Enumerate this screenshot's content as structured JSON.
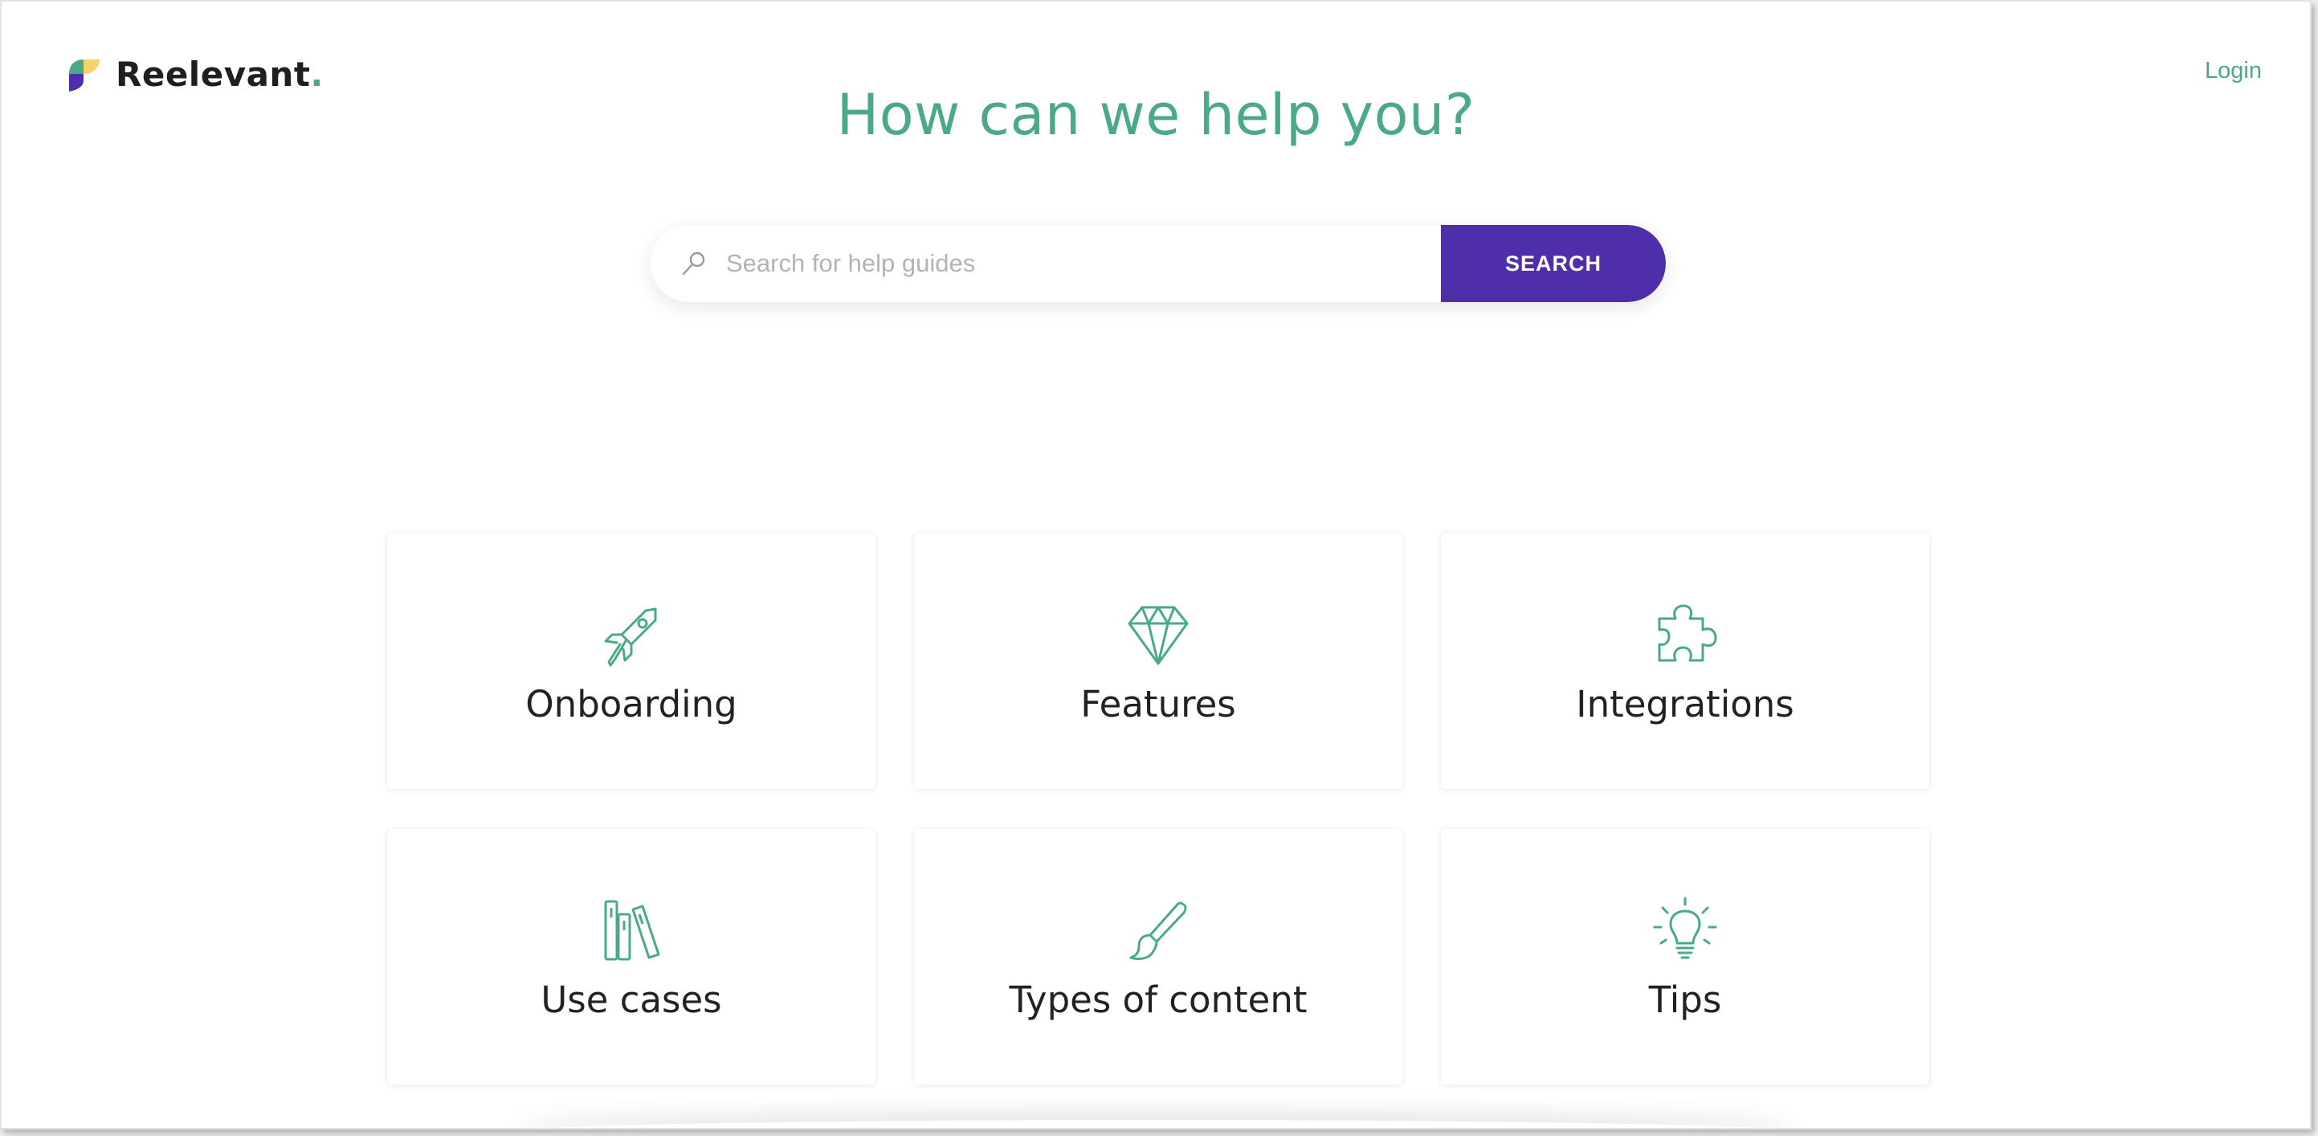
{
  "brand": {
    "name": "Reelevant",
    "dot": ".",
    "colors": {
      "green": "#4aa989",
      "purple": "#4f2fa9",
      "yellow": "#f7d36b"
    }
  },
  "header": {
    "login_label": "Login"
  },
  "hero": {
    "title": "How can we help you?"
  },
  "search": {
    "placeholder": "Search for help guides",
    "button_label": "SEARCH"
  },
  "categories": [
    {
      "label": "Onboarding",
      "icon": "rocket-icon"
    },
    {
      "label": "Features",
      "icon": "diamond-icon"
    },
    {
      "label": "Integrations",
      "icon": "puzzle-icon"
    },
    {
      "label": "Use cases",
      "icon": "books-icon"
    },
    {
      "label": "Types of content",
      "icon": "paintbrush-icon"
    },
    {
      "label": "Tips",
      "icon": "lightbulb-icon"
    }
  ]
}
